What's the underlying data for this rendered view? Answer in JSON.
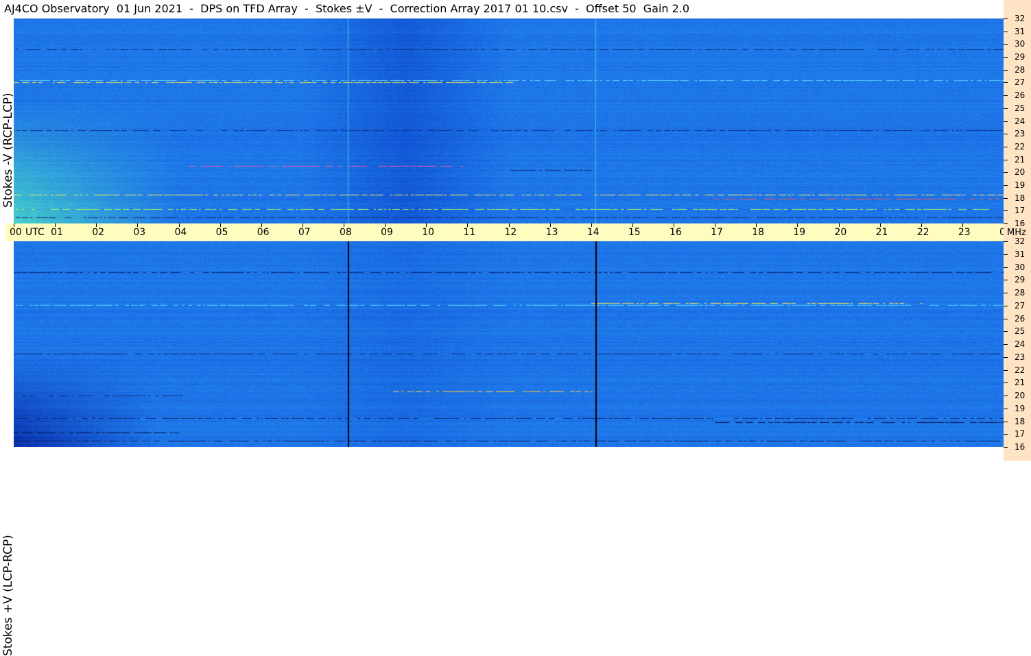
{
  "title": "AJ4CO Observatory  01 Jun 2021  -  DPS on TFD Array  -  Stokes ±V  -  Correction Array 2017 01 10.csv  -  Offset 50  Gain 2.0",
  "panels": {
    "top_label": "Stokes -V (RCP-LCP)",
    "bottom_label": "Stokes +V (LCP-RCP)"
  },
  "x_axis": {
    "utc_labels": [
      "00",
      "UTC",
      "01",
      "02",
      "03",
      "04",
      "05",
      "06",
      "07",
      "08",
      "09",
      "10",
      "11",
      "12",
      "13",
      "14",
      "15",
      "16",
      "17",
      "18",
      "19",
      "20",
      "21",
      "22",
      "23",
      "00"
    ],
    "unit": "MHz"
  },
  "y_axis": {
    "ticks": [
      "32",
      "31",
      "30",
      "29",
      "28",
      "27",
      "26",
      "25",
      "24",
      "23",
      "22",
      "21",
      "20",
      "19",
      "18",
      "17",
      "16"
    ]
  },
  "colors": {
    "base_blue": "#1f78e8",
    "header_yellow": "#fffcc0",
    "axis_peach": "#fee3c4"
  },
  "chart_data": {
    "type": "heatmap",
    "title": "AJ4CO Observatory  01 Jun 2021  -  DPS on TFD Array  -  Stokes ±V  -  Correction Array 2017 01 10.csv  -  Offset 50  Gain 2.0",
    "x_range_utc_hours": [
      0,
      24
    ],
    "y_range_mhz": [
      16,
      32
    ],
    "series": [
      {
        "name": "Stokes -V (RCP-LCP)"
      },
      {
        "name": "Stokes +V (LCP-RCP)"
      }
    ],
    "vertical_markers_utc": [
      8.1,
      14.1
    ]
  }
}
